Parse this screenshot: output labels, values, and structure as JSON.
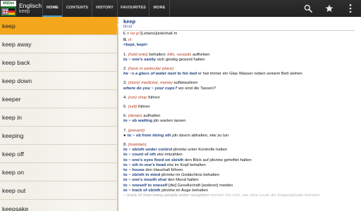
{
  "app": {
    "logo_text": "MSDict",
    "title": "Englisch",
    "subtitle": "keep"
  },
  "tabs": [
    "HOME",
    "CONTENTS",
    "HISTORY",
    "FAVOURITES",
    "MORE"
  ],
  "active_tab": "HOME",
  "action_icons": [
    "search-icon",
    "star-icon",
    "overflow-menu-icon"
  ],
  "colors": {
    "selection": "#f4a71c",
    "tab_indicator": "#3a9fd6",
    "headword": "#1d3f7f",
    "label": "#b23a1e"
  },
  "word_list": [
    "keep",
    "keep away",
    "keep back",
    "keep down",
    "keeper",
    "keep in",
    "keeping",
    "keep off",
    "keep on",
    "keep out",
    "keepsake"
  ],
  "selected_word": "keep",
  "entry": {
    "headword": "keep",
    "pronunciation": "[ki:p]",
    "sense1": {
      "num": "I.",
      "pos": "n no pl",
      "text": "[Lebens]unterhalt",
      "gender": "m"
    },
    "sense2": {
      "num": "II.",
      "pos": "vt"
    },
    "forms": "<kept, kept>",
    "senses": [
      {
        "n": "1.",
        "label": "(hold onto)",
        "text": "behalten;",
        "label2": "bills, receipts",
        "text2": "aufheben",
        "phrase": "to ~ one's sanity",
        "phrase_tr": "sich geistig gesund halten"
      },
      {
        "n": "2.",
        "label": "(have in particular place)",
        "text": "",
        "example": "he ~s a glass of water next to his bed",
        "example_tr": "er hat immer ein Glas Wasser neben seinem Bett stehen"
      },
      {
        "n": "3.",
        "label": "(store)",
        "label2": "medicine, money",
        "text": "aufbewahren",
        "example": "where do you ~ your cups?",
        "example_tr": "wo sind die Tassen?"
      },
      {
        "n": "4.",
        "label": "(run)",
        "label2": "shop",
        "text": "führen"
      },
      {
        "n": "5.",
        "label": "(sell)",
        "text": "führen"
      },
      {
        "n": "6.",
        "label": "(detain)",
        "text": "aufhalten",
        "phrase": "to ~ sb waiting",
        "phrase_tr": "jdn warten lassen"
      },
      {
        "n": "7.",
        "label": "(prevent)",
        "phrase": "to ~ sb from doing sth",
        "phrase_tr": "jdn davon abhalten, etw zu tun"
      },
      {
        "n": "8.",
        "label": "(maintain)"
      }
    ],
    "maintain_phrases": [
      {
        "p": "to ~ sb/sth under control",
        "t": "jdn/etw unter Kontrolle halten"
      },
      {
        "p": "to ~ count of sth",
        "t": "etw mitzählen"
      },
      {
        "p": "to ~ one's eyes fixed on sb/sth",
        "t": "den Blick auf jdn/etw geheftet halten"
      },
      {
        "p": "to ~ sth in one's head",
        "t": "etw im Kopf behalten"
      },
      {
        "p": "to ~ house",
        "t": "den Haushalt führen"
      },
      {
        "p": "to ~ sb/sth in mind",
        "t": "jdn/etw im Gedächtnis behalten"
      },
      {
        "p": "to ~ one's mouth shut",
        "t": "den Mund halten"
      },
      {
        "p": "to ~ oneself to oneself",
        "t": "[die] Gesellschaft [anderer] meiden"
      },
      {
        "p": "to ~ track of sb/sth",
        "t": "jdn/etw im Auge behalten"
      },
      {
        "p": "~ track of how many people enter reception",
        "t": "merken Sie sich, wie viele Leute die Eingangshalle betreten"
      }
    ]
  }
}
